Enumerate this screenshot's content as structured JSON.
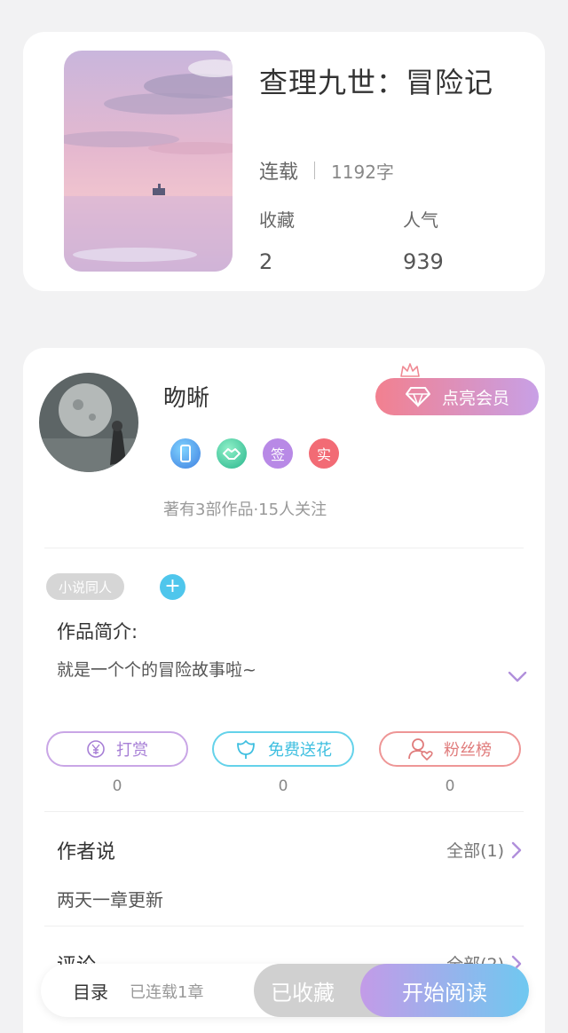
{
  "book": {
    "title": "查理九世：冒险记",
    "status": "连载",
    "word_count": "1192字",
    "favorites_label": "收藏",
    "favorites_value": "2",
    "popularity_label": "人气",
    "popularity_value": "939"
  },
  "author": {
    "name": "昒晰",
    "vip_button": "点亮会员",
    "badges": [
      "签",
      "实"
    ],
    "meta": "著有3部作品·15人关注"
  },
  "tags": {
    "items": [
      "小说同人"
    ],
    "add_label": "+"
  },
  "intro": {
    "title": "作品简介:",
    "text": "就是一个个的冒险故事啦~"
  },
  "actions": [
    {
      "label": "打赏",
      "count": "0",
      "icon": "yen-coin-icon"
    },
    {
      "label": "免费送花",
      "count": "0",
      "icon": "flower-icon"
    },
    {
      "label": "粉丝榜",
      "count": "0",
      "icon": "fan-heart-icon"
    }
  ],
  "author_says": {
    "title": "作者说",
    "more": "全部(1)",
    "content": "两天一章更新"
  },
  "comments": {
    "title": "评论",
    "more": "全部(2)"
  },
  "bottom_bar": {
    "toc": "目录",
    "toc_count": "已连载1章",
    "favorited": "已收藏",
    "start_reading": "开始阅读"
  },
  "colors": {
    "vip_gradient_start": "#f2808f",
    "vip_gradient_end": "#c8a0e6",
    "read_gradient_start": "#c39be8",
    "read_gradient_end": "#6fc8f0"
  }
}
